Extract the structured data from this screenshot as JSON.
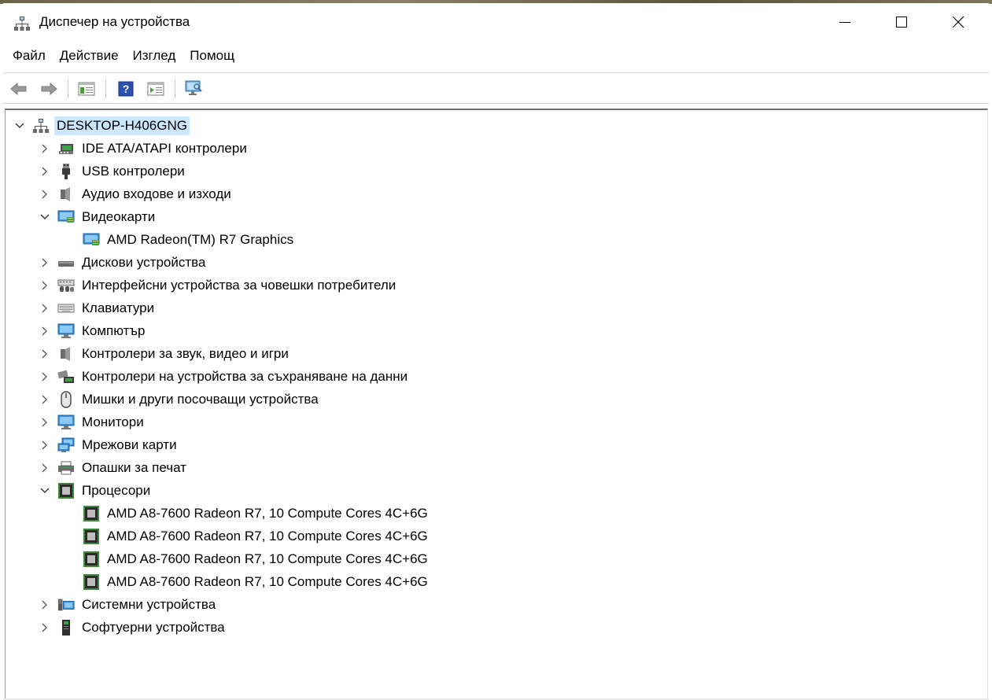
{
  "window": {
    "title": "Диспечер на устройства",
    "minimize_glyph": "—",
    "maximize_glyph": "☐",
    "close_glyph": "✕"
  },
  "menu": [
    "Файл",
    "Действие",
    "Изглед",
    "Помощ"
  ],
  "toolbar": [
    "back-icon",
    "forward-icon",
    "properties-icon",
    "help-icon",
    "update-driver-icon",
    "scan-hardware-icon"
  ],
  "tree": {
    "root": {
      "label": "DESKTOP-H406GNG",
      "icon": "computer-network-icon",
      "expanded": true
    },
    "items": [
      {
        "label": "IDE ATA/ATAPI контролери",
        "icon": "ide-controller-icon",
        "expanded": false,
        "level": 1
      },
      {
        "label": "USB контролери",
        "icon": "usb-icon",
        "expanded": false,
        "level": 1
      },
      {
        "label": "Аудио входове и изходи",
        "icon": "speaker-icon",
        "expanded": false,
        "level": 1
      },
      {
        "label": "Видеокарти",
        "icon": "display-adapter-icon",
        "expanded": true,
        "level": 1
      },
      {
        "label": "AMD Radeon(TM) R7 Graphics",
        "icon": "display-adapter-icon",
        "level": 2
      },
      {
        "label": "Дискови устройства",
        "icon": "disk-drive-icon",
        "expanded": false,
        "level": 1
      },
      {
        "label": "Интерфейсни устройства за човешки потребители",
        "icon": "hid-icon",
        "expanded": false,
        "level": 1
      },
      {
        "label": "Клавиатури",
        "icon": "keyboard-icon",
        "expanded": false,
        "level": 1
      },
      {
        "label": "Компютър",
        "icon": "monitor-icon",
        "expanded": false,
        "level": 1
      },
      {
        "label": "Контролери за звук, видео и игри",
        "icon": "speaker-icon",
        "expanded": false,
        "level": 1
      },
      {
        "label": "Контролери на устройства за съхраняване на данни",
        "icon": "storage-controller-icon",
        "expanded": false,
        "level": 1
      },
      {
        "label": "Мишки и други посочващи устройства",
        "icon": "mouse-icon",
        "expanded": false,
        "level": 1
      },
      {
        "label": "Монитори",
        "icon": "monitor-icon",
        "expanded": false,
        "level": 1
      },
      {
        "label": "Мрежови карти",
        "icon": "network-adapter-icon",
        "expanded": false,
        "level": 1
      },
      {
        "label": "Опашки за печат",
        "icon": "printer-icon",
        "expanded": false,
        "level": 1
      },
      {
        "label": "Процесори",
        "icon": "processor-icon",
        "expanded": true,
        "level": 1
      },
      {
        "label": "AMD A8-7600 Radeon R7, 10 Compute Cores 4C+6G",
        "icon": "processor-icon",
        "level": 2
      },
      {
        "label": "AMD A8-7600 Radeon R7, 10 Compute Cores 4C+6G",
        "icon": "processor-icon",
        "level": 2
      },
      {
        "label": "AMD A8-7600 Radeon R7, 10 Compute Cores 4C+6G",
        "icon": "processor-icon",
        "level": 2
      },
      {
        "label": "AMD A8-7600 Radeon R7, 10 Compute Cores 4C+6G",
        "icon": "processor-icon",
        "level": 2
      },
      {
        "label": "Системни устройства",
        "icon": "system-devices-icon",
        "expanded": false,
        "level": 1
      },
      {
        "label": "Софтуерни устройства",
        "icon": "software-device-icon",
        "expanded": false,
        "level": 1
      }
    ]
  }
}
